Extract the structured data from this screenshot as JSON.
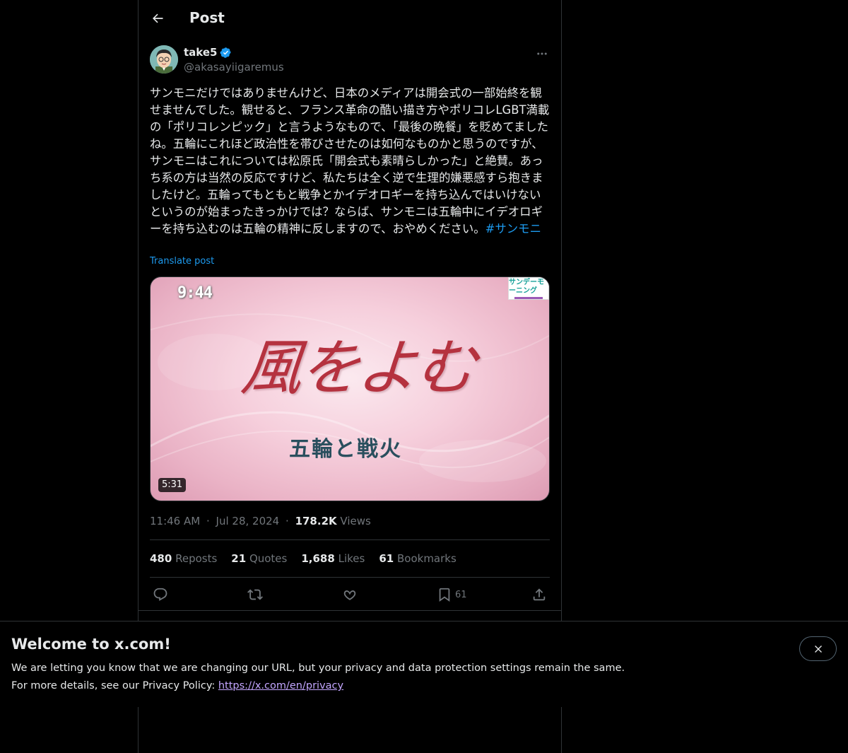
{
  "header": {
    "title": "Post"
  },
  "post": {
    "display_name": "take5",
    "handle": "@akasayiigaremus",
    "text": "サンモニだけではありませんけど、日本のメディアは開会式の一部始終を観せませんでした。観せると、フランス革命の酷い描き方やポリコレLGBT満載の「ポリコレンピック」と言うようなもので、「最後の晩餐」を貶めてましたね。五輪にこれほど政治性を帯びさせたのは如何なものかと思うのですが、サンモニはこれについては松原氏「開会式も素晴らしかった」と絶賛。あっち系の方は当然の反応ですけど、私たちは全く逆で生理的嫌悪感すら抱きましたけど。五輪ってもともと戦争とかイデオロギーを持ち込んではいけないというのが始まったきっかけでは？ならば、サンモニは五輪中にイデオロギーを持ち込むのは五輪の精神に反しますので、おやめください。",
    "hashtag": "#サンモニ",
    "translate_label": "Translate post",
    "media": {
      "video_time": "9:44",
      "channel_logo": "サンデーモーニング",
      "title": "風をよむ",
      "subtitle": "五輪と戦火",
      "duration": "5:31"
    },
    "time": "11:46 AM",
    "dot": "·",
    "date": "Jul 28, 2024",
    "views_count": "178.2K",
    "views_label": "Views",
    "stats": {
      "reposts_count": "480",
      "reposts_label": "Reposts",
      "quotes_count": "21",
      "quotes_label": "Quotes",
      "likes_count": "1,688",
      "likes_label": "Likes",
      "bookmarks_count": "61",
      "bookmarks_label": "Bookmarks"
    },
    "actions": {
      "bookmark_count": "61"
    }
  },
  "banner": {
    "title": "Welcome to x.com!",
    "line1": "We are letting you know that we are changing our URL, but your privacy and data protection settings remain the same.",
    "line2_prefix": "For more details, see our Privacy Policy: ",
    "link": "https://x.com/en/privacy"
  },
  "colors": {
    "accent": "#1d9bf0",
    "background": "#000000",
    "text": "#e7e9ea",
    "muted": "#71767b",
    "border": "#2f3336",
    "link_visited": "#c3a6ff"
  },
  "icons": [
    "back-arrow-icon",
    "verified-badge-icon",
    "more-icon",
    "reply-icon",
    "repost-icon",
    "like-icon",
    "bookmark-icon",
    "share-icon",
    "close-icon"
  ]
}
